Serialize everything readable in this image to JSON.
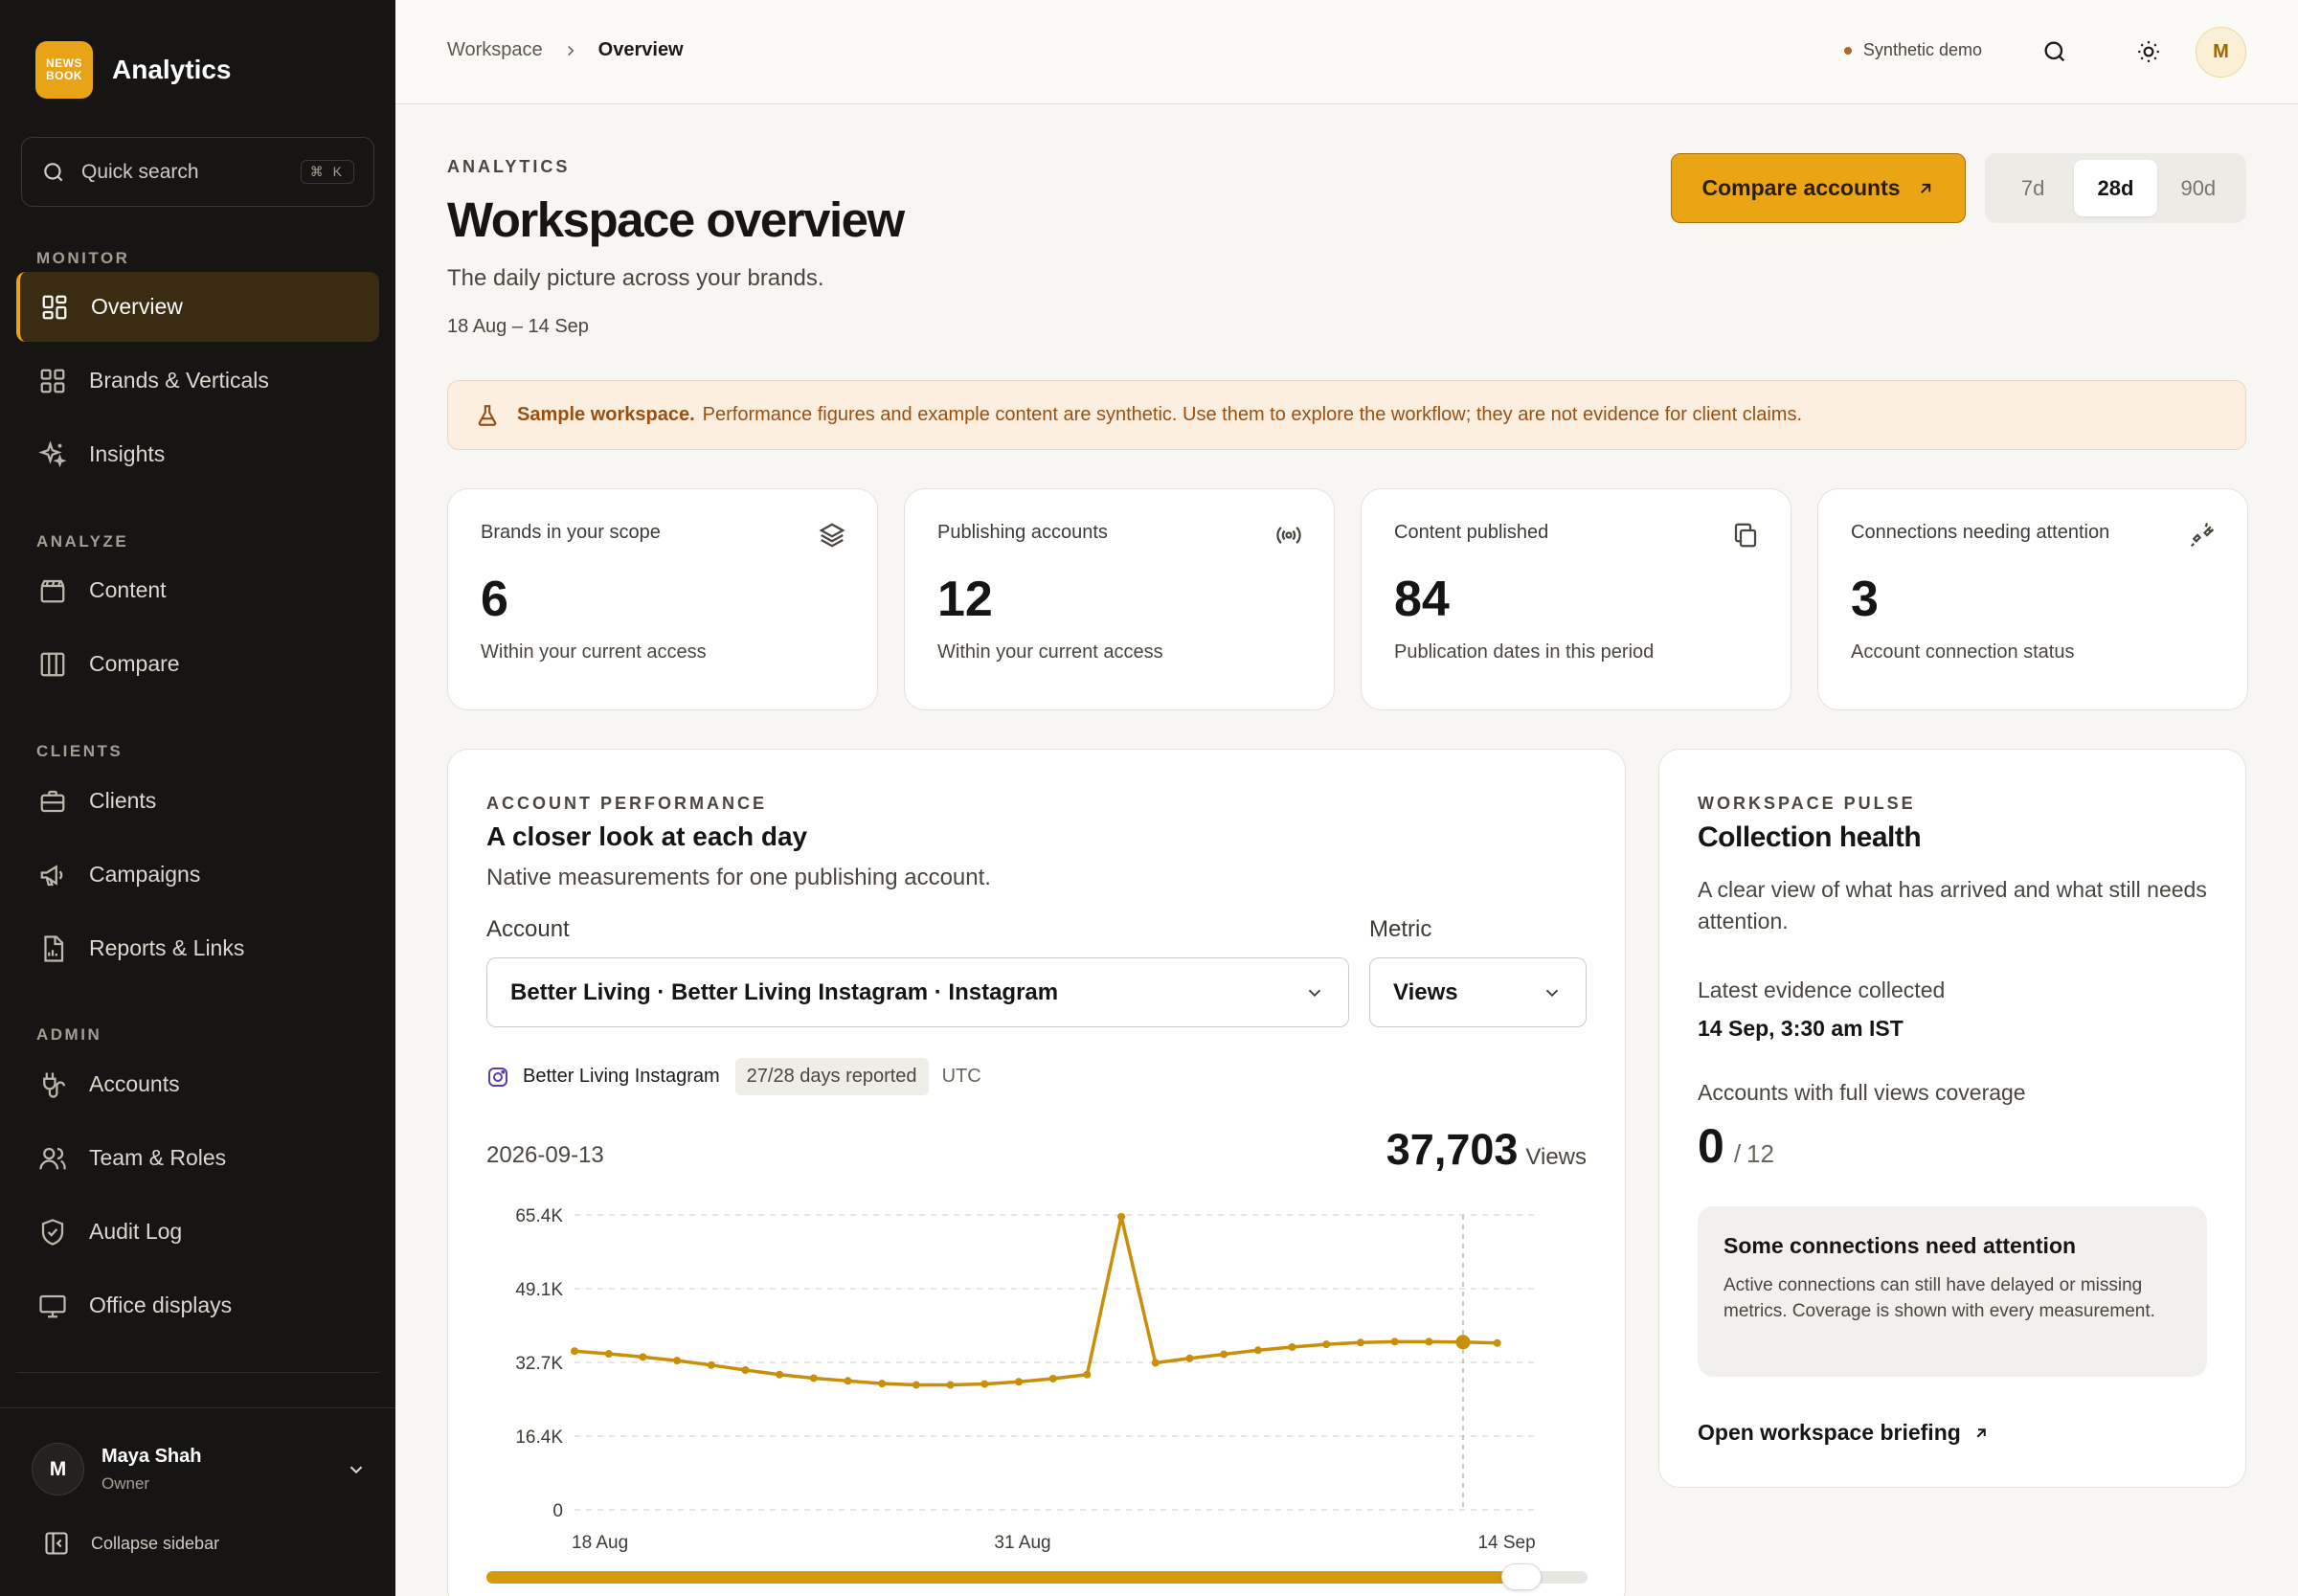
{
  "app": {
    "logo_line1": "NEWS",
    "logo_line2": "BOOK",
    "name": "Analytics"
  },
  "search": {
    "label": "Quick search",
    "shortcut": "⌘ K"
  },
  "sidebar": {
    "sections": [
      {
        "title": "MONITOR",
        "items": [
          {
            "label": "Overview",
            "icon": "grid-icon",
            "active": true
          },
          {
            "label": "Brands & Verticals",
            "icon": "squares-icon"
          },
          {
            "label": "Insights",
            "icon": "sparkles-icon"
          }
        ]
      },
      {
        "title": "ANALYZE",
        "items": [
          {
            "label": "Content",
            "icon": "clapperboard-icon"
          },
          {
            "label": "Compare",
            "icon": "columns-icon"
          }
        ]
      },
      {
        "title": "CLIENTS",
        "items": [
          {
            "label": "Clients",
            "icon": "briefcase-icon"
          },
          {
            "label": "Campaigns",
            "icon": "megaphone-icon"
          },
          {
            "label": "Reports & Links",
            "icon": "report-icon"
          }
        ]
      },
      {
        "title": "ADMIN",
        "items": [
          {
            "label": "Accounts",
            "icon": "plug-icon"
          },
          {
            "label": "Team & Roles",
            "icon": "users-icon"
          },
          {
            "label": "Audit Log",
            "icon": "shield-check-icon"
          },
          {
            "label": "Office displays",
            "icon": "monitor-icon"
          }
        ]
      }
    ],
    "user": {
      "initial": "M",
      "name": "Maya Shah",
      "role": "Owner"
    },
    "collapse_label": "Collapse sidebar"
  },
  "topbar": {
    "breadcrumb": [
      "Workspace",
      "Overview"
    ],
    "demo_label": "Synthetic demo",
    "avatar_initial": "M"
  },
  "header": {
    "eyebrow": "ANALYTICS",
    "title": "Workspace overview",
    "subtitle": "The daily picture across your brands.",
    "date_range": "18 Aug – 14 Sep",
    "compare_button": "Compare accounts",
    "periods": [
      "7d",
      "28d",
      "90d"
    ],
    "selected_period": "28d"
  },
  "banner": {
    "strong": "Sample workspace.",
    "text": "Performance figures and example content are synthetic. Use them to explore the workflow; they are not evidence for client claims."
  },
  "kpis": [
    {
      "label": "Brands in your scope",
      "value": "6",
      "note": "Within your current access",
      "icon": "layers-icon"
    },
    {
      "label": "Publishing accounts",
      "value": "12",
      "note": "Within your current access",
      "icon": "broadcast-icon"
    },
    {
      "label": "Content published",
      "value": "84",
      "note": "Publication dates in this period",
      "icon": "copy-icon"
    },
    {
      "label": "Connections needing attention",
      "value": "3",
      "note": "Account connection status",
      "icon": "unplug-icon"
    }
  ],
  "performance": {
    "eyebrow": "ACCOUNT PERFORMANCE",
    "title": "A closer look at each day",
    "subtitle": "Native measurements for one publishing account.",
    "account_label": "Account",
    "account_value": "Better Living · Better Living Instagram · Instagram",
    "metric_label": "Metric",
    "metric_value": "Views",
    "account_name": "Better Living Instagram",
    "days_reported": "27/28 days reported",
    "timezone": "UTC",
    "selected_date": "2026-09-13",
    "selected_value": "37,703",
    "selected_unit": "Views",
    "range_fraction": 0.94
  },
  "chart_data": {
    "type": "line",
    "x_tick_labels": [
      "18 Aug",
      "31 Aug",
      "14 Sep"
    ],
    "y_tick_labels": [
      "65.4K",
      "49.1K",
      "32.7K",
      "16.4K",
      "0"
    ],
    "ylim": [
      0,
      65400
    ],
    "grid": true,
    "series": [
      {
        "color": "#c98f0b",
        "values": [
          35200,
          34600,
          33900,
          33100,
          32100,
          31000,
          30000,
          29200,
          28600,
          28000,
          27700,
          27700,
          27900,
          28400,
          29100,
          30000,
          65000,
          32600,
          33600,
          34500,
          35400,
          36100,
          36700,
          37100,
          37300,
          37300,
          37200,
          37000
        ]
      }
    ],
    "highlight_index": 26
  },
  "pulse": {
    "eyebrow": "WORKSPACE PULSE",
    "title": "Collection health",
    "subtitle": "A clear view of what has arrived and what still needs attention.",
    "latest_label": "Latest evidence collected",
    "latest_value": "14 Sep, 3:30 am IST",
    "coverage_label": "Accounts with full views coverage",
    "coverage_value": "0",
    "coverage_total": "12",
    "attention_title": "Some connections need attention",
    "attention_body": "Active connections can still have delayed or missing metrics. Coverage is shown with every measurement.",
    "briefing_link": "Open workspace briefing"
  }
}
